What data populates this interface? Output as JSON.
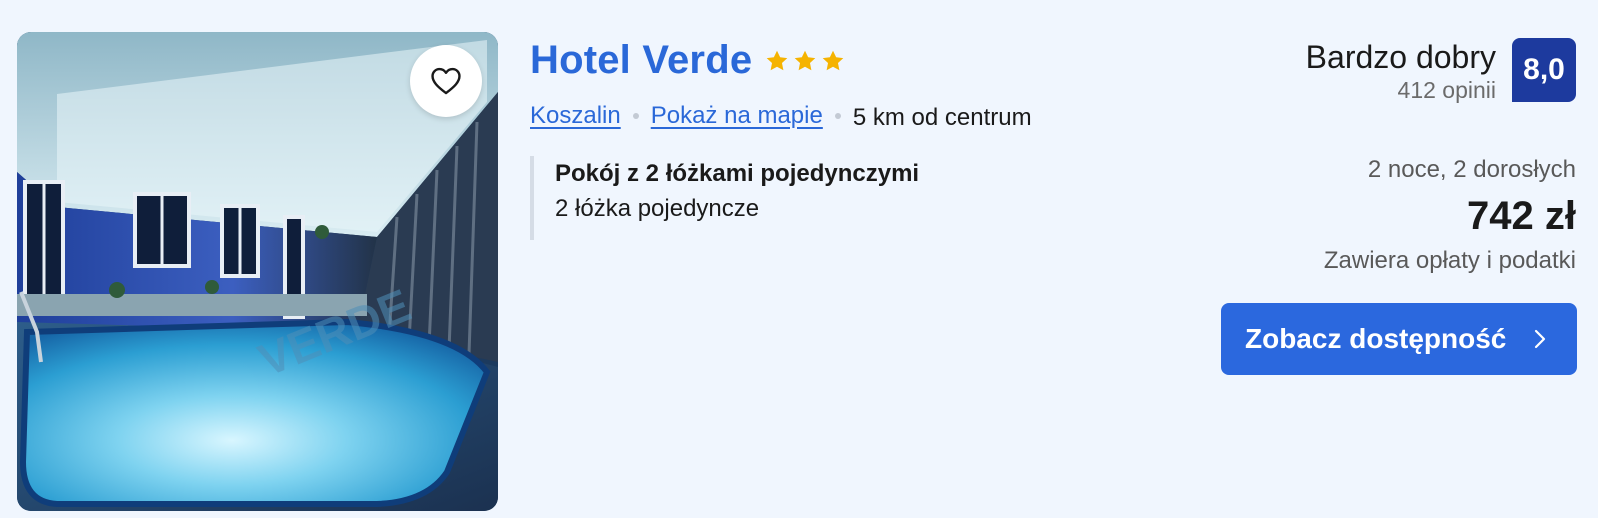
{
  "hotel": {
    "name": "Hotel Verde",
    "stars": 3,
    "star_color": "#f5b301",
    "name_color": "#2a68d8"
  },
  "location": {
    "city": "Koszalin",
    "map_link": "Pokaż na mapie",
    "distance": "5 km od centrum"
  },
  "room": {
    "name": "Pokój z 2 łóżkami pojedynczymi",
    "beds": "2 łóżka pojedyncze"
  },
  "review": {
    "word": "Bardzo dobry",
    "count": "412 opinii",
    "score": "8,0",
    "score_color": "#1d3a9e"
  },
  "pricing": {
    "stay": "2 noce, 2 dorosłych",
    "price": "742 zł",
    "taxes": "Zawiera opłaty i podatki"
  },
  "cta": {
    "label": "Zobacz dostępność",
    "icon": "chevron-right-icon",
    "color": "#2b68de"
  },
  "photo": {
    "icon": "heart-icon"
  }
}
